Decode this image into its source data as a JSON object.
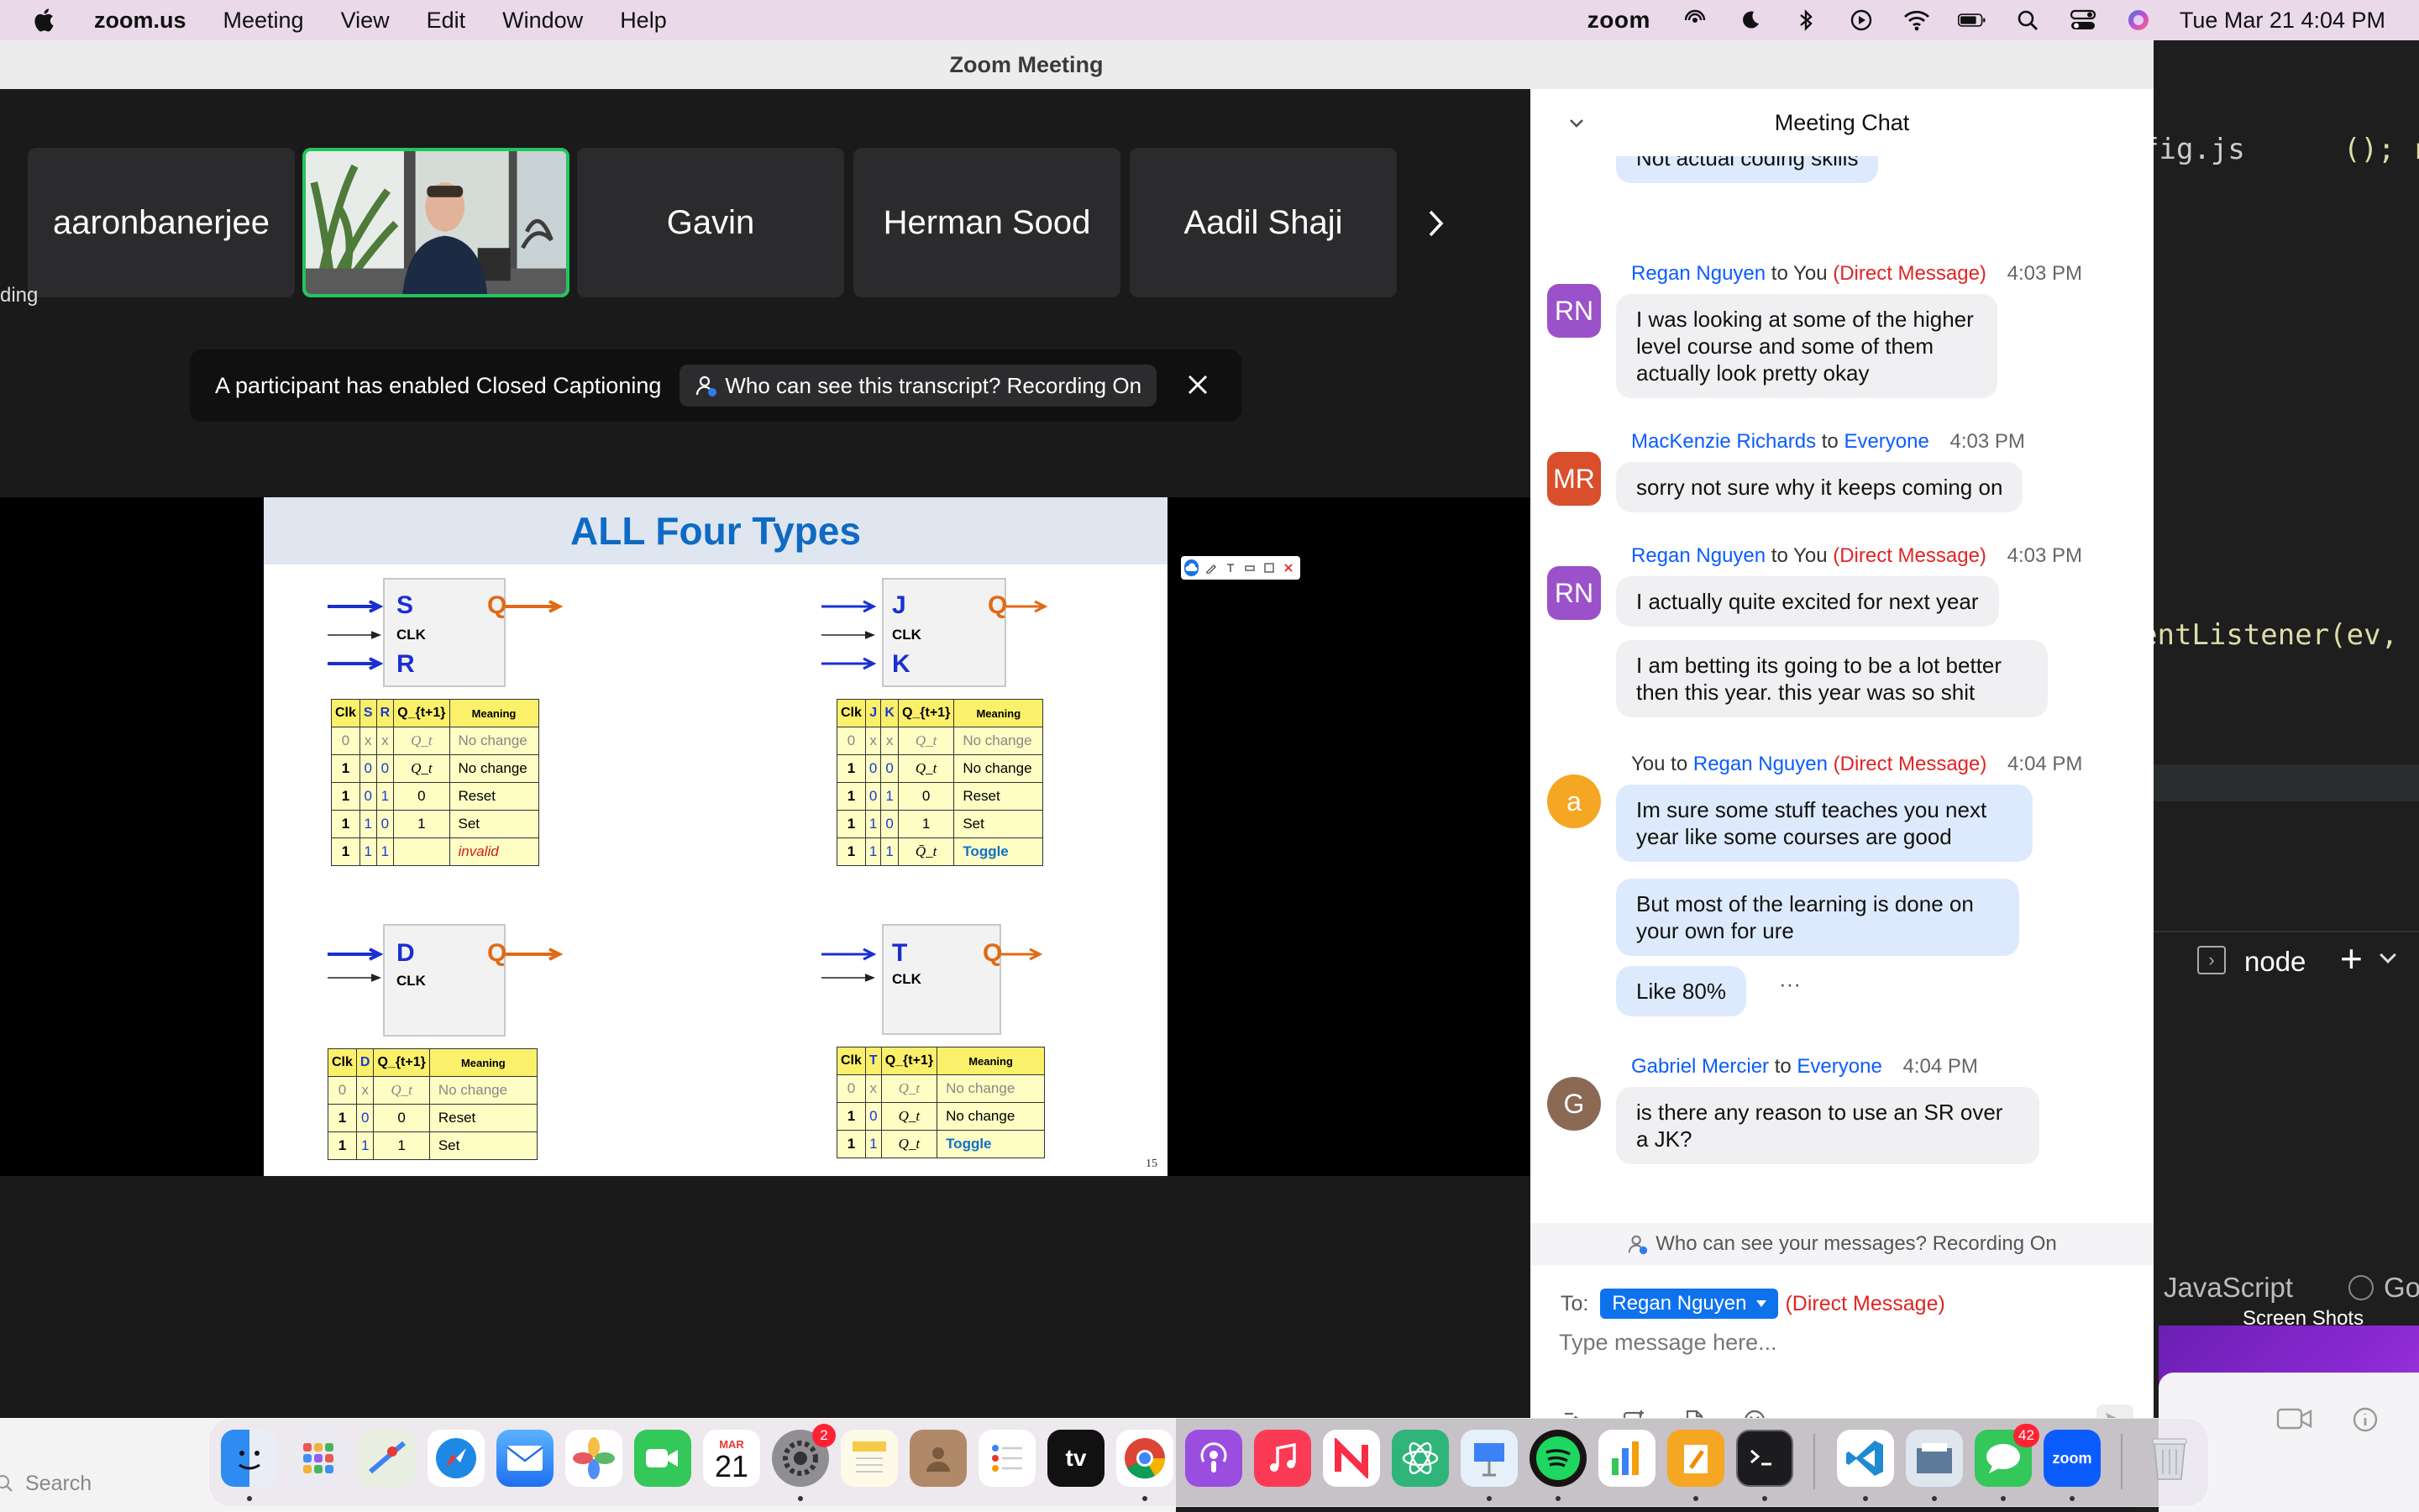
{
  "menubar": {
    "app_name": "zoom.us",
    "menus": [
      "Meeting",
      "View",
      "Edit",
      "Window",
      "Help"
    ],
    "zoom_word": "zoom",
    "clock": "Tue Mar 21  4:04 PM"
  },
  "editor_bg": {
    "file_tab": "fig.js",
    "tab_right": "(); re",
    "code_line": "entListener(ev,",
    "terminal_label": "node",
    "status_lang": "JavaScript",
    "status_go": "Go",
    "shots_label": "Screen Shots"
  },
  "zoom": {
    "window_title": "Zoom Meeting",
    "participants": [
      "aaronbanerjee",
      "",
      "Gavin",
      "Herman Sood",
      "Aadil Shaji"
    ],
    "side_label": "ding",
    "cc_banner": {
      "text": "A participant has enabled Closed Captioning",
      "pill": "Who can see this transcript? Recording On"
    }
  },
  "slide": {
    "title": "ALL Four Types",
    "page": "15",
    "sr": {
      "in1": "S",
      "in2": "R",
      "clk": "CLK",
      "out": "Q",
      "headers": [
        "Clk",
        "S",
        "R",
        "Q_{t+1}",
        "Meaning"
      ],
      "rows": [
        [
          "0",
          "x",
          "x",
          "Q_t",
          "No change"
        ],
        [
          "1",
          "0",
          "0",
          "Q_t",
          "No change"
        ],
        [
          "1",
          "0",
          "1",
          "0",
          "Reset"
        ],
        [
          "1",
          "1",
          "0",
          "1",
          "Set"
        ],
        [
          "1",
          "1",
          "1",
          "",
          "invalid"
        ]
      ]
    },
    "jk": {
      "in1": "J",
      "in2": "K",
      "clk": "CLK",
      "out": "Q",
      "headers": [
        "Clk",
        "J",
        "K",
        "Q_{t+1}",
        "Meaning"
      ],
      "rows": [
        [
          "0",
          "x",
          "x",
          "Q_t",
          "No change"
        ],
        [
          "1",
          "0",
          "0",
          "Q_t",
          "No change"
        ],
        [
          "1",
          "0",
          "1",
          "0",
          "Reset"
        ],
        [
          "1",
          "1",
          "0",
          "1",
          "Set"
        ],
        [
          "1",
          "1",
          "1",
          "Q̄_t",
          "Toggle"
        ]
      ]
    },
    "d": {
      "in1": "D",
      "clk": "CLK",
      "out": "Q",
      "headers": [
        "Clk",
        "D",
        "Q_{t+1}",
        "Meaning"
      ],
      "rows": [
        [
          "0",
          "x",
          "Q_t",
          "No change"
        ],
        [
          "1",
          "0",
          "0",
          "Reset"
        ],
        [
          "1",
          "1",
          "1",
          "Set"
        ]
      ]
    },
    "t": {
      "in1": "T",
      "clk": "CLK",
      "out": "Q",
      "headers": [
        "Clk",
        "T",
        "Q_{t+1}",
        "Meaning"
      ],
      "rows": [
        [
          "0",
          "x",
          "Q_t",
          "No change"
        ],
        [
          "1",
          "0",
          "Q_t",
          "No change"
        ],
        [
          "1",
          "1",
          "Q_t",
          "Toggle"
        ]
      ]
    }
  },
  "chat": {
    "header": "Meeting Chat",
    "partial_msg": "Not actual coding skills",
    "messages": [
      {
        "avatar": "RN",
        "avatar_color": "#9b51c9",
        "from": "Regan Nguyen",
        "to": "You",
        "dm": "(Direct Message)",
        "time": "4:03 PM",
        "bubbles": [
          "I was looking at some of the higher level course and some of them actually look pretty okay"
        ]
      },
      {
        "avatar": "MR",
        "avatar_color": "#d94e2b",
        "from": "MacKenzie Richards",
        "to": "Everyone",
        "dm": "",
        "time": "4:03 PM",
        "bubbles": [
          "sorry not sure why it keeps coming on"
        ]
      },
      {
        "avatar": "RN",
        "avatar_color": "#9b51c9",
        "from": "Regan Nguyen",
        "to": "You",
        "dm": "(Direct Message)",
        "time": "4:03 PM",
        "bubbles": [
          "I actually quite excited for next year",
          "I am betting its going to be a lot better then this year. this year was so shit"
        ]
      },
      {
        "avatar": "a",
        "avatar_color": "#f5a623",
        "from": "You",
        "to": "Regan Nguyen",
        "dm": "(Direct Message)",
        "time": "4:04 PM",
        "bubbles": [
          "Im sure some stuff teaches you next year like some courses are good",
          "But most of the learning is done on your own for ure",
          "Like 80%"
        ]
      },
      {
        "avatar": "G",
        "avatar_color": "#8a6a55",
        "from": "Gabriel Mercier",
        "to": "Everyone",
        "dm": "",
        "time": "4:04 PM",
        "bubbles": [
          "is there any reason to use an SR over a JK?"
        ]
      }
    ],
    "to_word": "to",
    "more": "···",
    "notice": "Who can see your messages? Recording On",
    "to_label": "To:",
    "recipient": "Regan Nguyen",
    "recipient_dm": "(Direct Message)",
    "input_placeholder": "Type message here..."
  },
  "desktop": {
    "search_label": "Search"
  },
  "dock": {
    "calendar_month": "MAR",
    "calendar_day": "21",
    "settings_badge": "2",
    "messages_badge": "42",
    "tv_label": "tv",
    "zoom_label": "zoom"
  },
  "colors": {
    "zoom_blue": "#0b5cff",
    "dm_red": "#e02424",
    "active_green": "#22c55e",
    "slide_title_blue": "#0e6ac4"
  }
}
